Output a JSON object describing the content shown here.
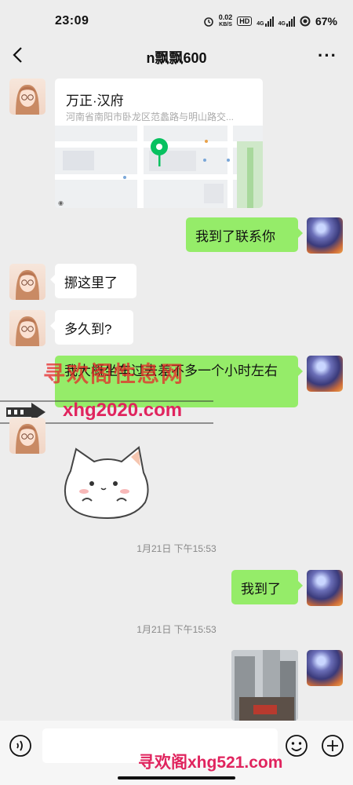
{
  "status_bar": {
    "time": "23:09",
    "net_speed_value": "0.02",
    "net_speed_unit": "KB/S",
    "hd_label": "HD",
    "sig1_label": "4G",
    "sig2_label": "4G",
    "battery": "67%"
  },
  "header": {
    "title": "n飘飘600"
  },
  "messages": {
    "location": {
      "title": "万正·汉府",
      "address": "河南省南阳市卧龙区范蠡路与明山路交..."
    },
    "msg_arrived_contact": "我到了联系你",
    "msg_here": "挪这里了",
    "msg_how_long": "多久到?",
    "msg_hour": "我大概坐车过去差不多一个小时左右",
    "time1": "1月21日 下午15:53",
    "msg_arrived": "我到了",
    "time2": "1月21日 下午15:53"
  },
  "watermarks": {
    "top_cn": "寻欢阁性息网",
    "url": "xhg2020.com",
    "bottom": "寻欢阁xhg521.com"
  },
  "colors": {
    "background": "#ededed",
    "bubble_green": "#95ec69",
    "bubble_white": "#ffffff",
    "map_pin": "#07c160",
    "watermark_red": "#e0245e"
  }
}
